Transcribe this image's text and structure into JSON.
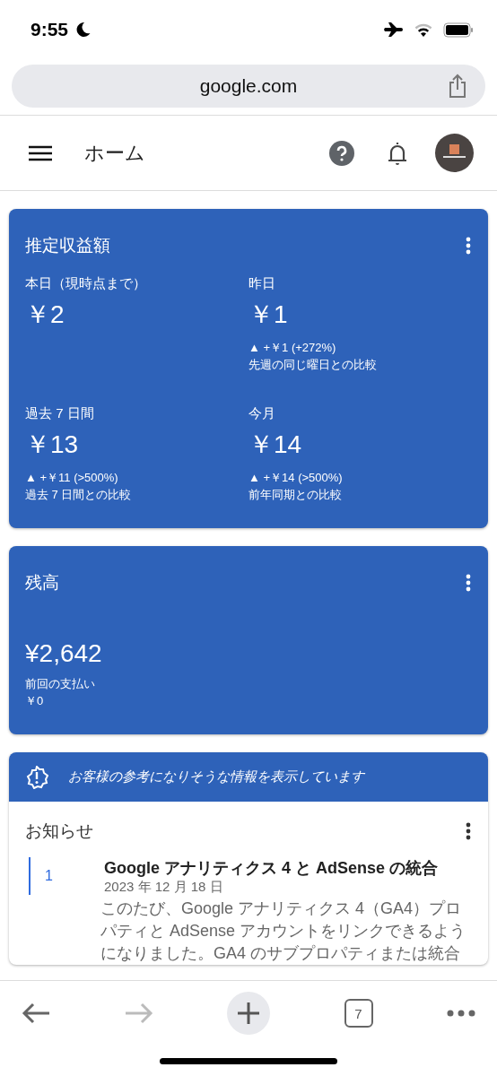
{
  "status_bar": {
    "time": "9:55"
  },
  "browser": {
    "url": "google.com",
    "tab_count": "7",
    "forward_enabled": false
  },
  "app_bar": {
    "title": "ホーム"
  },
  "earnings_card": {
    "title": "推定収益額",
    "metrics": [
      {
        "label": "本日（現時点まで）",
        "value": "￥2"
      },
      {
        "label": "昨日",
        "value": "￥1",
        "change": "▲ +￥1 (+272%)",
        "comparison": "先週の同じ曜日との比較"
      },
      {
        "label": "過去 7 日間",
        "value": "￥13",
        "change": "▲ +￥11 (>500%)",
        "comparison": "過去 7 日間との比較"
      },
      {
        "label": "今月",
        "value": "￥14",
        "change": "▲ +￥14 (>500%)",
        "comparison": "前年同期との比較"
      }
    ]
  },
  "balance_card": {
    "title": "残高",
    "amount": "¥2,642",
    "last_payment_label": "前回の支払い",
    "last_payment": "￥0"
  },
  "notice_banner": {
    "text": "お客様の参考になりそうな情報を表示しています"
  },
  "announcements": {
    "title": "お知らせ",
    "items": [
      {
        "number": "1",
        "title": "Google アナリティクス 4 と AdSense の統合",
        "date": "2023 年 12 月 18 日",
        "body": "このたび、Google アナリティクス 4（GA4）プロパティと AdSense アカウントをリンクできるようになりました。GA4 のサブプロパティまたは統合"
      }
    ]
  }
}
